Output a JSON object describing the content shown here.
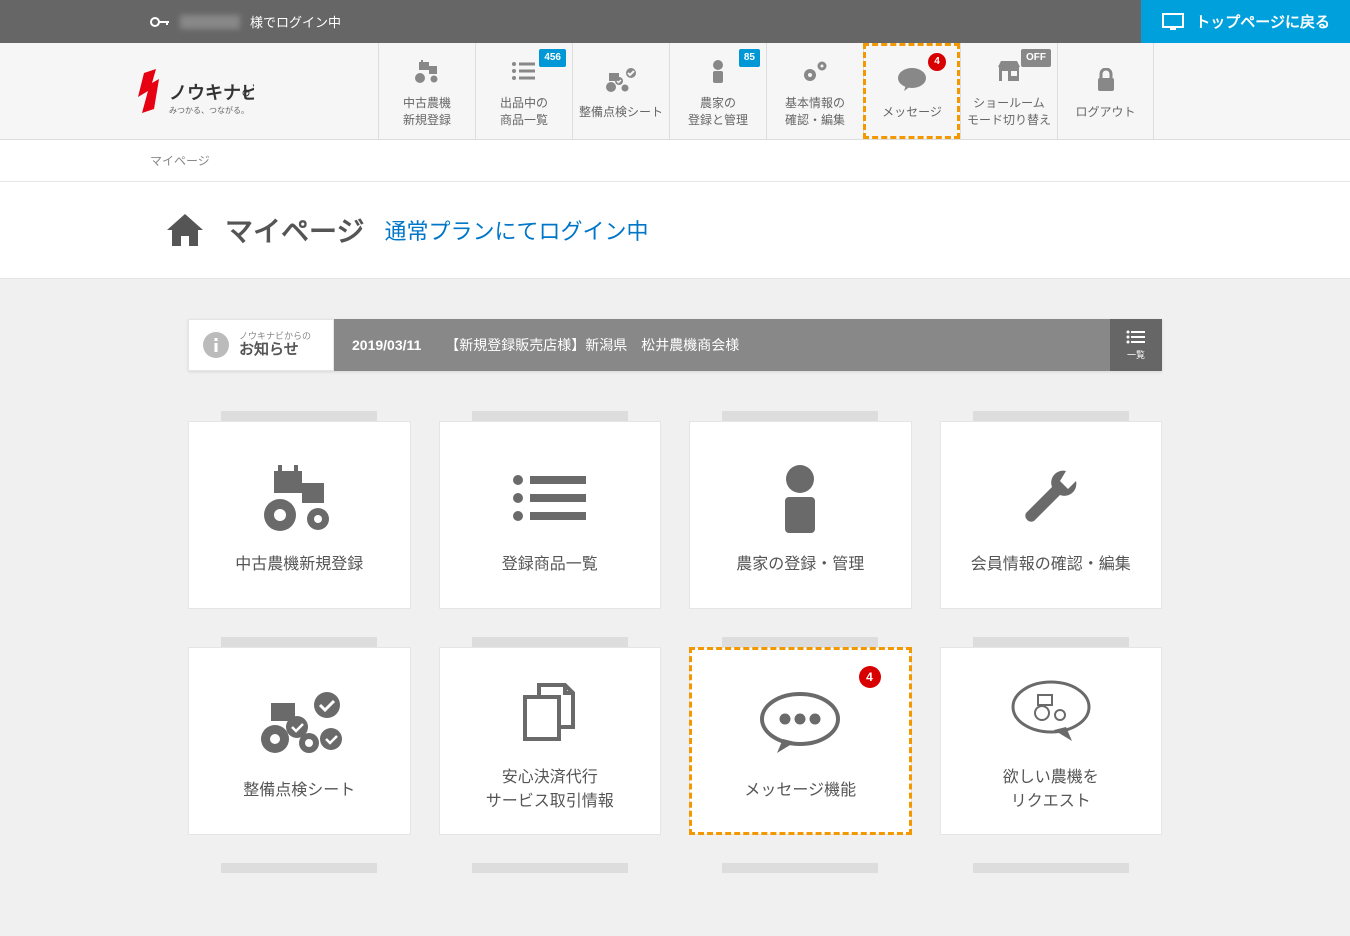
{
  "topbar": {
    "login_suffix": "様でログイン中",
    "back_to_top": "トップページに戻る"
  },
  "logo": {
    "name": "ノウキナビ",
    "tagline": "みつかる、つながる。"
  },
  "nav": [
    {
      "id": "register",
      "label_line1": "中古農機",
      "label_line2": "新規登録",
      "badge": null,
      "icon": "tractor"
    },
    {
      "id": "listing",
      "label_line1": "出品中の",
      "label_line2": "商品一覧",
      "badge": "456",
      "badge_type": "blue",
      "icon": "list"
    },
    {
      "id": "inspection",
      "label_line1": "整備点検シート",
      "label_line2": "",
      "badge": null,
      "icon": "tractor-check"
    },
    {
      "id": "farmer",
      "label_line1": "農家の",
      "label_line2": "登録と管理",
      "badge": "85",
      "badge_type": "blue",
      "icon": "person"
    },
    {
      "id": "profile",
      "label_line1": "基本情報の",
      "label_line2": "確認・編集",
      "badge": null,
      "icon": "gears"
    },
    {
      "id": "message",
      "label_line1": "メッセージ",
      "label_line2": "",
      "badge": "4",
      "badge_type": "count",
      "icon": "speech",
      "highlighted": true
    },
    {
      "id": "showroom",
      "label_line1": "ショールーム",
      "label_line2": "モード切り替え",
      "badge": "OFF",
      "badge_type": "off",
      "icon": "store"
    },
    {
      "id": "logout",
      "label_line1": "ログアウト",
      "label_line2": "",
      "badge": null,
      "icon": "lock"
    }
  ],
  "breadcrumb": "マイページ",
  "page": {
    "title": "マイページ",
    "plan_status": "通常プランにてログイン中"
  },
  "notice": {
    "sub": "ノウキナビからの",
    "main": "お知らせ",
    "date": "2019/03/11",
    "text": "【新規登録販売店様】新潟県　松井農機商会様",
    "list_btn": "一覧"
  },
  "cards": [
    {
      "id": "register",
      "label": "中古農機新規登録",
      "icon": "tractor"
    },
    {
      "id": "listing",
      "label": "登録商品一覧",
      "icon": "list"
    },
    {
      "id": "farmer",
      "label": "農家の登録・管理",
      "icon": "person"
    },
    {
      "id": "profile",
      "label": "会員情報の確認・編集",
      "icon": "wrench"
    },
    {
      "id": "inspection",
      "label": "整備点検シート",
      "icon": "tractor-check"
    },
    {
      "id": "payment",
      "label_line1": "安心決済代行",
      "label_line2": "サービス取引情報",
      "icon": "docs"
    },
    {
      "id": "message",
      "label": "メッセージ機能",
      "icon": "speech",
      "badge": "4",
      "highlighted": true
    },
    {
      "id": "request",
      "label_line1": "欲しい農機を",
      "label_line2": "リクエスト",
      "icon": "speech-tractor"
    }
  ]
}
